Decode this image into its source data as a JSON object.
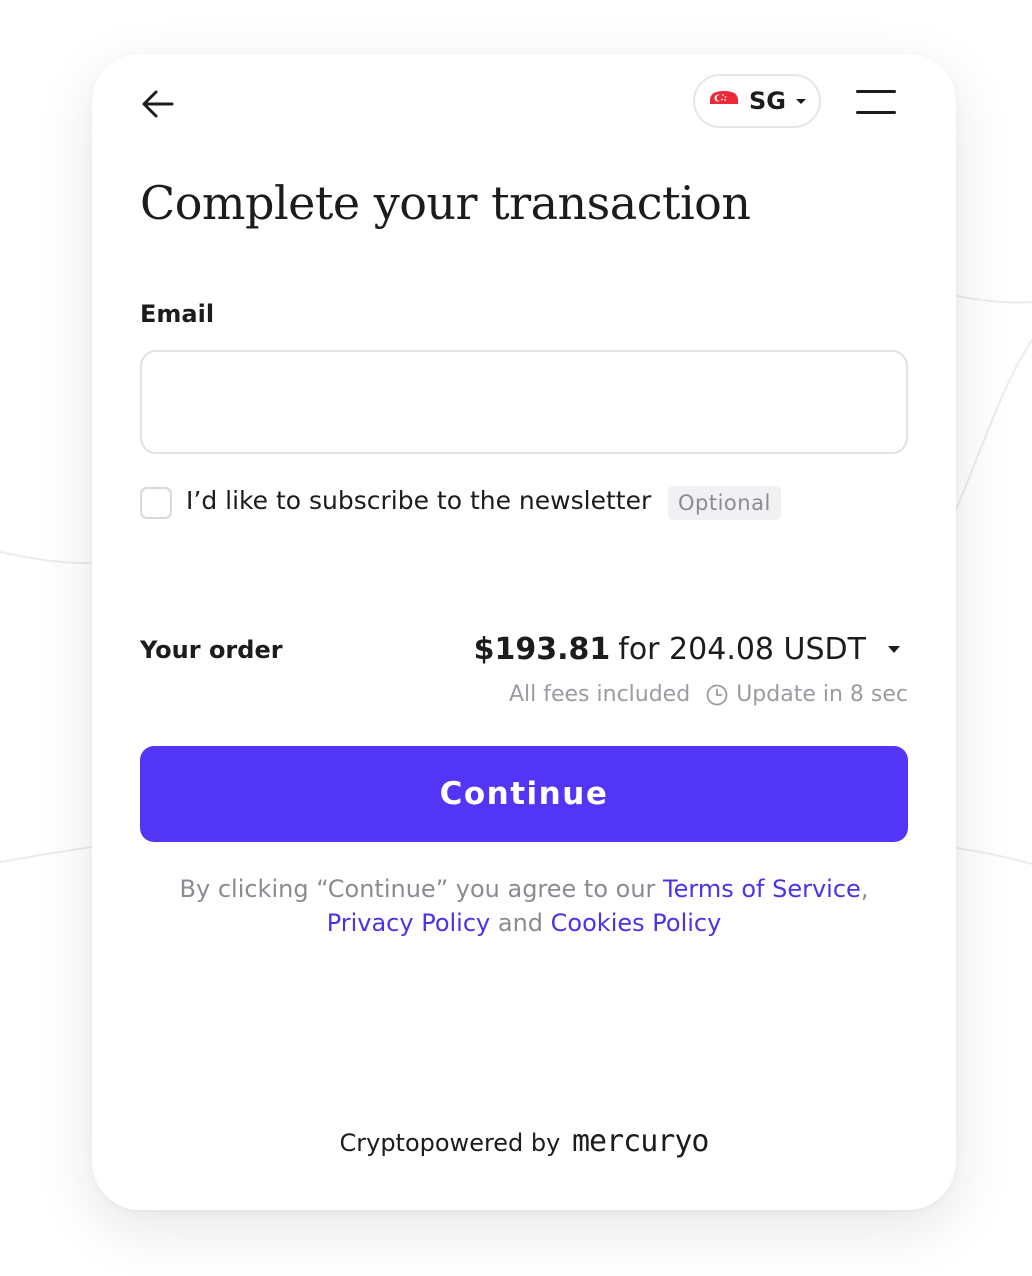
{
  "header": {
    "back_icon": "arrow-left-icon",
    "country": {
      "code": "SG",
      "flag_icon": "singapore-flag-icon",
      "flag_colors": [
        "#ed2939",
        "#ffffff"
      ]
    },
    "menu_icon": "hamburger-menu-icon"
  },
  "title": "Complete your transaction",
  "email": {
    "label": "Email",
    "value": "",
    "placeholder": ""
  },
  "newsletter": {
    "label": "I’d like to subscribe to the newsletter",
    "badge": "Optional",
    "checked": false
  },
  "order": {
    "label": "Your order",
    "price": "$193.81",
    "for_text": "for 204.08 USDT",
    "fees_note": "All fees included",
    "update_note": "Update in 8 sec"
  },
  "continue_label": "Continue",
  "legal": {
    "prefix": "By clicking “Continue” you agree to our ",
    "terms": "Terms of Service",
    "comma": ",",
    "privacy": "Privacy Policy",
    "and": " and ",
    "cookies": "Cookies Policy"
  },
  "footer": {
    "prefix": "Cryptopowered by",
    "brand": "mercuryo"
  },
  "colors": {
    "accent": "#5235f5",
    "link": "#4a33e8",
    "muted_text": "#8b8b92",
    "text": "#1c1c1e",
    "border": "#e2e2e6"
  }
}
